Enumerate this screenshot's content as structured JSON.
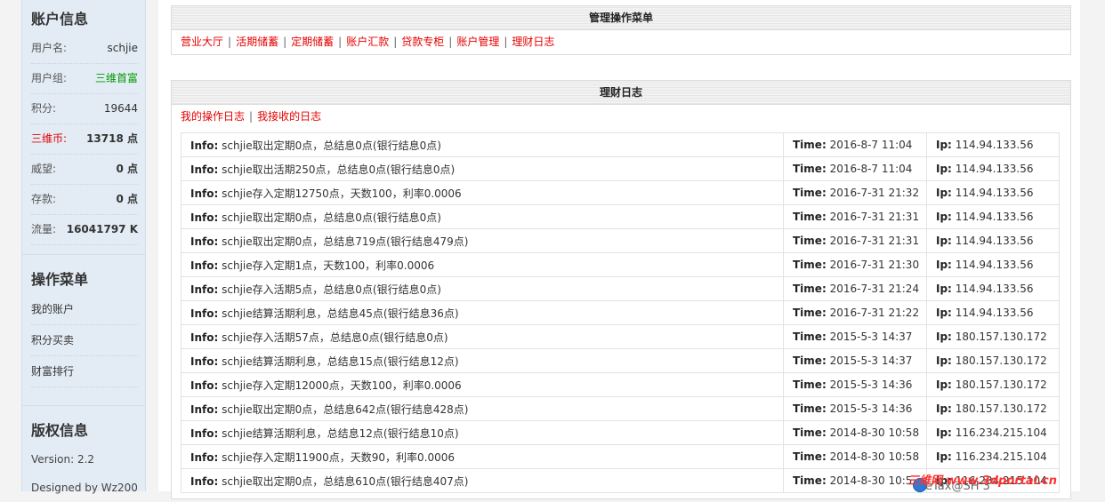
{
  "sidebar": {
    "account_title": "账户信息",
    "account_rows": [
      {
        "label": "用户名:",
        "value": "schjie"
      },
      {
        "label": "用户组:",
        "value": "三维首富"
      },
      {
        "label": "积分:",
        "value": "19644"
      },
      {
        "label": "三维币:",
        "value": "13718 点"
      },
      {
        "label": "威望:",
        "value": "0 点"
      },
      {
        "label": "存款:",
        "value": "0 点"
      },
      {
        "label": "流量:",
        "value": "16041797 K"
      }
    ],
    "menu_title": "操作菜单",
    "menu_items": [
      "我的账户",
      "积分买卖",
      "财富排行"
    ],
    "copyright_title": "版权信息",
    "copyright_rows": [
      "Version: 2.2",
      "Designed by Wz200..."
    ]
  },
  "menu_panel": {
    "title": "管理操作菜单",
    "links": [
      "营业大厅",
      "活期储蓄",
      "定期储蓄",
      "账户汇款",
      "贷款专柜",
      "账户管理",
      "理财日志"
    ]
  },
  "log_panel": {
    "title": "理财日志",
    "tabs": [
      "我的操作日志",
      "我接收的日志"
    ],
    "labels": {
      "info": "Info:",
      "time": "Time:",
      "ip": "Ip:"
    },
    "rows": [
      {
        "info": "schjie取出定期0点，总结息0点(银行结息0点)",
        "time": "2016-8-7 11:04",
        "ip": "114.94.133.56"
      },
      {
        "info": "schjie取出活期250点，总结息0点(银行结息0点)",
        "time": "2016-8-7 11:04",
        "ip": "114.94.133.56"
      },
      {
        "info": "schjie存入定期12750点，天数100，利率0.0006",
        "time": "2016-7-31 21:32",
        "ip": "114.94.133.56"
      },
      {
        "info": "schjie取出定期0点，总结息0点(银行结息0点)",
        "time": "2016-7-31 21:31",
        "ip": "114.94.133.56"
      },
      {
        "info": "schjie取出定期0点，总结息719点(银行结息479点)",
        "time": "2016-7-31 21:31",
        "ip": "114.94.133.56"
      },
      {
        "info": "schjie存入定期1点，天数100，利率0.0006",
        "time": "2016-7-31 21:30",
        "ip": "114.94.133.56"
      },
      {
        "info": "schjie存入活期5点，总结息0点(银行结息0点)",
        "time": "2016-7-31 21:24",
        "ip": "114.94.133.56"
      },
      {
        "info": "schjie结算活期利息，总结息45点(银行结息36点)",
        "time": "2016-7-31 21:22",
        "ip": "114.94.133.56"
      },
      {
        "info": "schjie存入活期57点，总结息0点(银行结息0点)",
        "time": "2015-5-3 14:37",
        "ip": "180.157.130.172"
      },
      {
        "info": "schjie结算活期利息，总结息15点(银行结息12点)",
        "time": "2015-5-3 14:37",
        "ip": "180.157.130.172"
      },
      {
        "info": "schjie存入定期12000点，天数100，利率0.0006",
        "time": "2015-5-3 14:36",
        "ip": "180.157.130.172"
      },
      {
        "info": "schjie取出定期0点，总结息642点(银行结息428点)",
        "time": "2015-5-3 14:36",
        "ip": "180.157.130.172"
      },
      {
        "info": "schjie结算活期利息，总结息12点(银行结息10点)",
        "time": "2014-8-30 10:58",
        "ip": "116.234.215.104"
      },
      {
        "info": "schjie存入定期11900点，天数90，利率0.0006",
        "time": "2014-8-30 10:58",
        "ip": "116.234.215.104"
      },
      {
        "info": "schjie取出定期0点，总结息610点(银行结息407点)",
        "time": "2014-8-30 10:5",
        "ip": "116.234.215.104"
      }
    ]
  },
  "watermark": {
    "text": "三维网 www.3dportal.cn",
    "overlay": "eTax@SH 3"
  }
}
